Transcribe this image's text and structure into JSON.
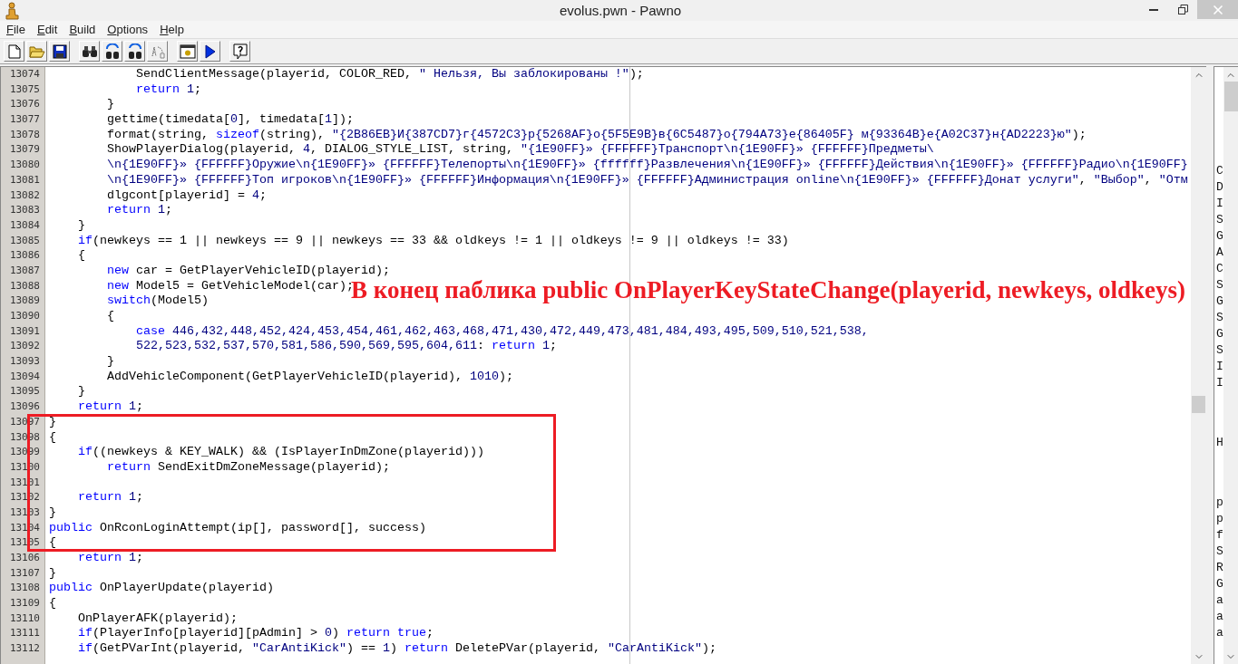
{
  "window": {
    "title": "evolus.pwn - Pawno"
  },
  "menu": [
    "File",
    "Edit",
    "Build",
    "Options",
    "Help"
  ],
  "editor": {
    "lines": [
      {
        "number": "13074",
        "tokens": [
          {
            "kind": "text",
            "text": "            SendClientMessage(playerid, COLOR_RED, "
          },
          {
            "kind": "string",
            "text": "\" Нельзя, Вы заблокированы !\""
          },
          {
            "kind": "text",
            "text": ");"
          }
        ]
      },
      {
        "number": "13075",
        "tokens": [
          {
            "kind": "keyword",
            "text": "            return"
          },
          {
            "kind": "number",
            "text": " 1"
          },
          {
            "kind": "text",
            "text": ";"
          }
        ]
      },
      {
        "number": "13076",
        "tokens": [
          {
            "kind": "text",
            "text": "        }"
          }
        ]
      },
      {
        "number": "13077",
        "tokens": [
          {
            "kind": "text",
            "text": "        gettime(timedata["
          },
          {
            "kind": "number",
            "text": "0"
          },
          {
            "kind": "text",
            "text": "], timedata["
          },
          {
            "kind": "number",
            "text": "1"
          },
          {
            "kind": "text",
            "text": "]);"
          }
        ]
      },
      {
        "number": "13078",
        "tokens": [
          {
            "kind": "text",
            "text": "        format(string, "
          },
          {
            "kind": "keyword",
            "text": "sizeof"
          },
          {
            "kind": "text",
            "text": "(string), "
          },
          {
            "kind": "string",
            "text": "\"{2B86EB}И{387CD7}г{4572C3}р{5268AF}о{5F5E9B}в{6C5487}о{794A73}е{86405F} м{93364B}е{A02C37}н{AD2223}ю\""
          },
          {
            "kind": "text",
            "text": ");"
          }
        ]
      },
      {
        "number": "13079",
        "tokens": [
          {
            "kind": "text",
            "text": "        ShowPlayerDialog(playerid, "
          },
          {
            "kind": "number",
            "text": "4"
          },
          {
            "kind": "text",
            "text": ", DIALOG_STYLE_LIST, string, "
          },
          {
            "kind": "string",
            "text": "\"{1E90FF}» {FFFFFF}Транспорт\\n{1E90FF}» {FFFFFF}Предметы\\"
          }
        ]
      },
      {
        "number": "13080",
        "tokens": [
          {
            "kind": "string",
            "text": "        \\n{1E90FF}» {FFFFFF}Оружие\\n{1E90FF}» {FFFFFF}Телепорты\\n{1E90FF}» {ffffff}Развлечения\\n{1E90FF}» {FFFFFF}Действия\\n{1E90FF}» {FFFFFF}Радио\\n{1E90FF}"
          }
        ]
      },
      {
        "number": "13081",
        "tokens": [
          {
            "kind": "string",
            "text": "        \\n{1E90FF}» {FFFFFF}Топ игроков\\n{1E90FF}» {FFFFFF}Информация\\n{1E90FF}» {FFFFFF}Администрация online\\n{1E90FF}» {FFFFFF}Донат услуги\""
          },
          {
            "kind": "text",
            "text": ", "
          },
          {
            "kind": "string",
            "text": "\"Выбор\""
          },
          {
            "kind": "text",
            "text": ", "
          },
          {
            "kind": "string",
            "text": "\"Отм"
          }
        ]
      },
      {
        "number": "13082",
        "tokens": [
          {
            "kind": "text",
            "text": "        dlgcont[playerid] = "
          },
          {
            "kind": "number",
            "text": "4"
          },
          {
            "kind": "text",
            "text": ";"
          }
        ]
      },
      {
        "number": "13083",
        "tokens": [
          {
            "kind": "keyword",
            "text": "        return"
          },
          {
            "kind": "number",
            "text": " 1"
          },
          {
            "kind": "text",
            "text": ";"
          }
        ]
      },
      {
        "number": "13084",
        "tokens": [
          {
            "kind": "text",
            "text": "    }"
          }
        ]
      },
      {
        "number": "13085",
        "tokens": [
          {
            "kind": "keyword",
            "text": "    if"
          },
          {
            "kind": "text",
            "text": "(newkeys == 1 || newkeys == 9 || newkeys == 33 && oldkeys != 1 || oldkeys != 9 || oldkeys != 33)"
          }
        ]
      },
      {
        "number": "13086",
        "tokens": [
          {
            "kind": "text",
            "text": "    {"
          }
        ]
      },
      {
        "number": "13087",
        "tokens": [
          {
            "kind": "keyword",
            "text": "        new"
          },
          {
            "kind": "text",
            "text": " car = GetPlayerVehicleID(playerid);"
          }
        ]
      },
      {
        "number": "13088",
        "tokens": [
          {
            "kind": "keyword",
            "text": "        new"
          },
          {
            "kind": "text",
            "text": " Model5 = GetVehicleModel(car);"
          }
        ]
      },
      {
        "number": "13089",
        "tokens": [
          {
            "kind": "keyword",
            "text": "        switch"
          },
          {
            "kind": "text",
            "text": "(Model5)"
          }
        ]
      },
      {
        "number": "13090",
        "tokens": [
          {
            "kind": "text",
            "text": "        {"
          }
        ]
      },
      {
        "number": "13091",
        "tokens": [
          {
            "kind": "keyword",
            "text": "            case"
          },
          {
            "kind": "number",
            "text": " 446,432,448,452,424,453,454,461,462,463,468,471,430,472,449,473,481,484,493,495,509,510,521,538,"
          }
        ]
      },
      {
        "number": "13092",
        "tokens": [
          {
            "kind": "number",
            "text": "            522,523,532,537,570,581,586,590,569,595,604,611"
          },
          {
            "kind": "text",
            "text": ": "
          },
          {
            "kind": "keyword",
            "text": "return"
          },
          {
            "kind": "number",
            "text": " 1"
          },
          {
            "kind": "text",
            "text": ";"
          }
        ]
      },
      {
        "number": "13093",
        "tokens": [
          {
            "kind": "text",
            "text": "        }"
          }
        ]
      },
      {
        "number": "13094",
        "tokens": [
          {
            "kind": "text",
            "text": "        AddVehicleComponent(GetPlayerVehicleID(playerid), "
          },
          {
            "kind": "number",
            "text": "1010"
          },
          {
            "kind": "text",
            "text": ");"
          }
        ]
      },
      {
        "number": "13095",
        "tokens": [
          {
            "kind": "text",
            "text": "    }"
          }
        ]
      },
      {
        "number": "13096",
        "tokens": [
          {
            "kind": "keyword",
            "text": "    return"
          },
          {
            "kind": "number",
            "text": " 1"
          },
          {
            "kind": "text",
            "text": ";"
          }
        ]
      },
      {
        "number": "13097",
        "tokens": [
          {
            "kind": "text",
            "text": "}"
          }
        ]
      },
      {
        "number": "13098",
        "tokens": [
          {
            "kind": "text",
            "text": "{"
          }
        ]
      },
      {
        "number": "13099",
        "tokens": [
          {
            "kind": "keyword",
            "text": "    if"
          },
          {
            "kind": "text",
            "text": "((newkeys & KEY_WALK) && (IsPlayerInDmZone(playerid)))"
          }
        ]
      },
      {
        "number": "13100",
        "tokens": [
          {
            "kind": "keyword",
            "text": "        return"
          },
          {
            "kind": "text",
            "text": " SendExitDmZoneMessage(playerid);"
          }
        ]
      },
      {
        "number": "13101"
      },
      {
        "number": "13102",
        "tokens": [
          {
            "kind": "keyword",
            "text": "    return"
          },
          {
            "kind": "number",
            "text": " 1"
          },
          {
            "kind": "text",
            "text": ";"
          }
        ]
      },
      {
        "number": "13103",
        "tokens": [
          {
            "kind": "text",
            "text": "}"
          }
        ]
      },
      {
        "number": "13104",
        "tokens": [
          {
            "kind": "keyword",
            "text": "public"
          },
          {
            "kind": "text",
            "text": " OnRconLoginAttempt(ip[], password[], success)"
          }
        ]
      },
      {
        "number": "13105",
        "tokens": [
          {
            "kind": "text",
            "text": "{"
          }
        ]
      },
      {
        "number": "13106",
        "tokens": [
          {
            "kind": "keyword",
            "text": "    return"
          },
          {
            "kind": "number",
            "text": " 1"
          },
          {
            "kind": "text",
            "text": ";"
          }
        ]
      },
      {
        "number": "13107",
        "tokens": [
          {
            "kind": "text",
            "text": "}"
          }
        ]
      },
      {
        "number": "13108",
        "tokens": [
          {
            "kind": "keyword",
            "text": "public"
          },
          {
            "kind": "text",
            "text": " OnPlayerUpdate(playerid)"
          }
        ]
      },
      {
        "number": "13109",
        "tokens": [
          {
            "kind": "text",
            "text": "{"
          }
        ]
      },
      {
        "number": "13110",
        "tokens": [
          {
            "kind": "text",
            "text": "    OnPlayerAFK(playerid);"
          }
        ]
      },
      {
        "number": "13111",
        "tokens": [
          {
            "kind": "keyword",
            "text": "    if"
          },
          {
            "kind": "text",
            "text": "(PlayerInfo[playerid][pAdmin] > "
          },
          {
            "kind": "number",
            "text": "0"
          },
          {
            "kind": "text",
            "text": ") "
          },
          {
            "kind": "keyword",
            "text": "return true"
          },
          {
            "kind": "text",
            "text": ";"
          }
        ]
      },
      {
        "number": "13112",
        "tokens": [
          {
            "kind": "keyword",
            "text": "    if"
          },
          {
            "kind": "text",
            "text": "(GetPVarInt(playerid, "
          },
          {
            "kind": "string",
            "text": "\"CarAntiKick\""
          },
          {
            "kind": "text",
            "text": ") == "
          },
          {
            "kind": "number",
            "text": "1"
          },
          {
            "kind": "text",
            "text": ") "
          },
          {
            "kind": "keyword",
            "text": "return"
          },
          {
            "kind": "text",
            "text": " DeletePVar(playerid, "
          },
          {
            "kind": "string",
            "text": "\"CarAntiKick\""
          },
          {
            "kind": "text",
            "text": ");"
          }
        ]
      }
    ]
  },
  "annotation": {
    "text": "В конец паблика public OnPlayerKeyStateChange(playerid, newkeys, oldkeys)"
  },
  "function_list": {
    "groups": [
      [
        "C",
        "D",
        "I",
        "S",
        "G",
        "A",
        "C",
        "S",
        "G",
        "S",
        "G",
        "S",
        "I",
        "I"
      ],
      [
        "H"
      ],
      [
        "p",
        "p",
        "f",
        "S",
        "R",
        "G",
        "a",
        "a",
        "a"
      ]
    ]
  }
}
